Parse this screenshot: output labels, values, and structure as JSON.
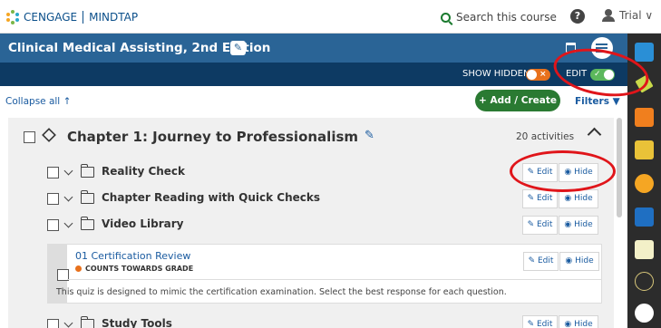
{
  "app": {
    "brand_left": "CENGAGE",
    "brand_right": "MINDTAP",
    "search_label": "Search this course",
    "help_label": "?",
    "user_label": "Trial ∨"
  },
  "course": {
    "title": "Clinical Medical Assisting, 2nd Edition",
    "edit_glyph": "✎"
  },
  "modes": {
    "show_hidden_label": "SHOW HIDDEN",
    "show_hidden_state": "off",
    "show_hidden_mark": "×",
    "edit_label": "EDIT",
    "edit_state": "on",
    "edit_mark": "✓"
  },
  "controls": {
    "collapse_label": "Collapse all  ↑",
    "add_label": "+ Add / Create",
    "filters_label": "Filters ▼"
  },
  "chapter": {
    "title": "Chapter 1: Journey to Professionalism",
    "edit_glyph": "✎",
    "count": "20 activities"
  },
  "folders": [
    {
      "title": "Reality Check",
      "edit": "✎ Edit",
      "hide": "◉ Hide"
    },
    {
      "title": "Chapter Reading with Quick Checks",
      "edit": "✎ Edit",
      "hide": "◉ Hide"
    },
    {
      "title": "Video Library",
      "edit": "✎ Edit",
      "hide": "◉ Hide"
    }
  ],
  "activity": {
    "title": "01 Certification Review",
    "badge": "COUNTS TOWARDS GRADE",
    "description": "This quiz is designed to mimic the certification examination. Select the best response for each question.",
    "edit": "✎ Edit",
    "hide": "◉ Hide"
  },
  "folder_last": {
    "title": "Study Tools",
    "edit": "✎ Edit",
    "hide": "◉ Hide"
  },
  "colors": {
    "course_bar": "#2a6496",
    "mode_bar": "#0d3a63",
    "add_button": "#2a7a32",
    "link": "#1a5ba0",
    "annotation": "#e0151a",
    "grade_dot": "#e8711c"
  },
  "rail_icons": [
    "briefcase-icon",
    "highlighter-icon",
    "rss-icon",
    "dictionary-icon",
    "flashcard-icon",
    "book-icon",
    "notes-icon",
    "readspeaker-icon",
    "cnow-icon"
  ]
}
